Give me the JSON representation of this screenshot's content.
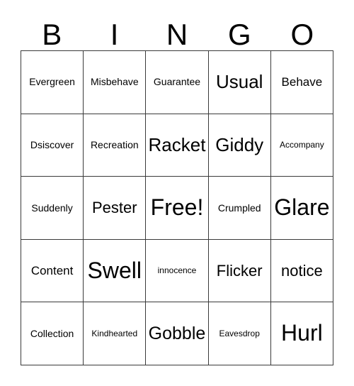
{
  "card": {
    "title": "BINGO",
    "header_letters": [
      "B",
      "I",
      "N",
      "G",
      "O"
    ],
    "free_space_label": "Free!",
    "rows": [
      [
        {
          "text": "Evergreen",
          "size": "sm"
        },
        {
          "text": "Misbehave",
          "size": "sm"
        },
        {
          "text": "Guarantee",
          "size": "sm"
        },
        {
          "text": "Usual",
          "size": "xl"
        },
        {
          "text": "Behave",
          "size": "md"
        }
      ],
      [
        {
          "text": "Dsiscover",
          "size": "sm"
        },
        {
          "text": "Recreation",
          "size": "sm"
        },
        {
          "text": "Racket",
          "size": "xl"
        },
        {
          "text": "Giddy",
          "size": "xl"
        },
        {
          "text": "Accompany",
          "size": "xs"
        }
      ],
      [
        {
          "text": "Suddenly",
          "size": "sm"
        },
        {
          "text": "Pester",
          "size": "lg"
        },
        {
          "text": "Free!",
          "size": "xxl"
        },
        {
          "text": "Crumpled",
          "size": "sm"
        },
        {
          "text": "Glare",
          "size": "xxl"
        }
      ],
      [
        {
          "text": "Content",
          "size": "md"
        },
        {
          "text": "Swell",
          "size": "xxl"
        },
        {
          "text": "innocence",
          "size": "xs"
        },
        {
          "text": "Flicker",
          "size": "lg"
        },
        {
          "text": "notice",
          "size": "lg"
        }
      ],
      [
        {
          "text": "Collection",
          "size": "sm"
        },
        {
          "text": "Kindhearted",
          "size": "xs"
        },
        {
          "text": "Gobble",
          "size": "xl"
        },
        {
          "text": "Eavesdrop",
          "size": "xs"
        },
        {
          "text": "Hurl",
          "size": "xxl"
        }
      ]
    ]
  },
  "colors": {
    "background": "#ffffff",
    "text": "#000000",
    "grid_line": "#3a3a3a"
  }
}
